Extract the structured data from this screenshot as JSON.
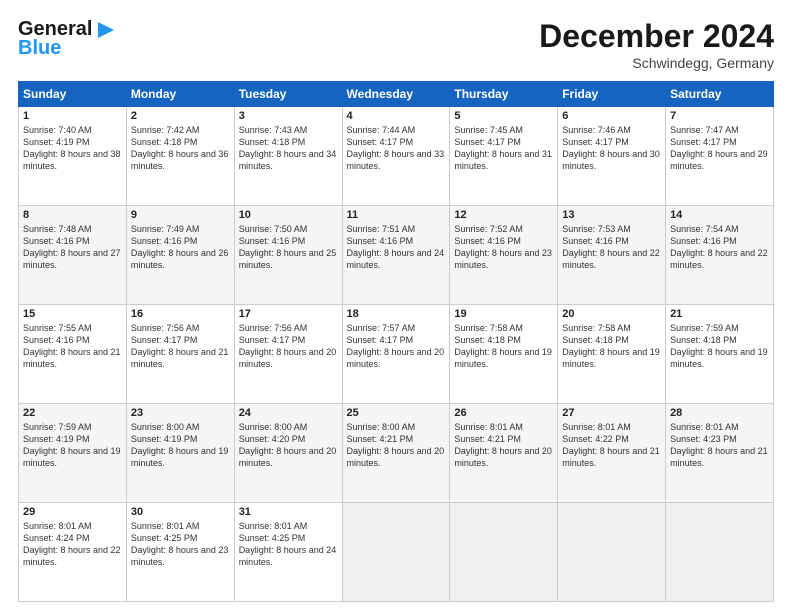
{
  "header": {
    "logo_general": "General",
    "logo_blue": "Blue",
    "month_title": "December 2024",
    "location": "Schwindegg, Germany"
  },
  "weekdays": [
    "Sunday",
    "Monday",
    "Tuesday",
    "Wednesday",
    "Thursday",
    "Friday",
    "Saturday"
  ],
  "weeks": [
    [
      {
        "day": "1",
        "sunrise": "Sunrise: 7:40 AM",
        "sunset": "Sunset: 4:19 PM",
        "daylight": "Daylight: 8 hours and 38 minutes."
      },
      {
        "day": "2",
        "sunrise": "Sunrise: 7:42 AM",
        "sunset": "Sunset: 4:18 PM",
        "daylight": "Daylight: 8 hours and 36 minutes."
      },
      {
        "day": "3",
        "sunrise": "Sunrise: 7:43 AM",
        "sunset": "Sunset: 4:18 PM",
        "daylight": "Daylight: 8 hours and 34 minutes."
      },
      {
        "day": "4",
        "sunrise": "Sunrise: 7:44 AM",
        "sunset": "Sunset: 4:17 PM",
        "daylight": "Daylight: 8 hours and 33 minutes."
      },
      {
        "day": "5",
        "sunrise": "Sunrise: 7:45 AM",
        "sunset": "Sunset: 4:17 PM",
        "daylight": "Daylight: 8 hours and 31 minutes."
      },
      {
        "day": "6",
        "sunrise": "Sunrise: 7:46 AM",
        "sunset": "Sunset: 4:17 PM",
        "daylight": "Daylight: 8 hours and 30 minutes."
      },
      {
        "day": "7",
        "sunrise": "Sunrise: 7:47 AM",
        "sunset": "Sunset: 4:17 PM",
        "daylight": "Daylight: 8 hours and 29 minutes."
      }
    ],
    [
      {
        "day": "8",
        "sunrise": "Sunrise: 7:48 AM",
        "sunset": "Sunset: 4:16 PM",
        "daylight": "Daylight: 8 hours and 27 minutes."
      },
      {
        "day": "9",
        "sunrise": "Sunrise: 7:49 AM",
        "sunset": "Sunset: 4:16 PM",
        "daylight": "Daylight: 8 hours and 26 minutes."
      },
      {
        "day": "10",
        "sunrise": "Sunrise: 7:50 AM",
        "sunset": "Sunset: 4:16 PM",
        "daylight": "Daylight: 8 hours and 25 minutes."
      },
      {
        "day": "11",
        "sunrise": "Sunrise: 7:51 AM",
        "sunset": "Sunset: 4:16 PM",
        "daylight": "Daylight: 8 hours and 24 minutes."
      },
      {
        "day": "12",
        "sunrise": "Sunrise: 7:52 AM",
        "sunset": "Sunset: 4:16 PM",
        "daylight": "Daylight: 8 hours and 23 minutes."
      },
      {
        "day": "13",
        "sunrise": "Sunrise: 7:53 AM",
        "sunset": "Sunset: 4:16 PM",
        "daylight": "Daylight: 8 hours and 22 minutes."
      },
      {
        "day": "14",
        "sunrise": "Sunrise: 7:54 AM",
        "sunset": "Sunset: 4:16 PM",
        "daylight": "Daylight: 8 hours and 22 minutes."
      }
    ],
    [
      {
        "day": "15",
        "sunrise": "Sunrise: 7:55 AM",
        "sunset": "Sunset: 4:16 PM",
        "daylight": "Daylight: 8 hours and 21 minutes."
      },
      {
        "day": "16",
        "sunrise": "Sunrise: 7:56 AM",
        "sunset": "Sunset: 4:17 PM",
        "daylight": "Daylight: 8 hours and 21 minutes."
      },
      {
        "day": "17",
        "sunrise": "Sunrise: 7:56 AM",
        "sunset": "Sunset: 4:17 PM",
        "daylight": "Daylight: 8 hours and 20 minutes."
      },
      {
        "day": "18",
        "sunrise": "Sunrise: 7:57 AM",
        "sunset": "Sunset: 4:17 PM",
        "daylight": "Daylight: 8 hours and 20 minutes."
      },
      {
        "day": "19",
        "sunrise": "Sunrise: 7:58 AM",
        "sunset": "Sunset: 4:18 PM",
        "daylight": "Daylight: 8 hours and 19 minutes."
      },
      {
        "day": "20",
        "sunrise": "Sunrise: 7:58 AM",
        "sunset": "Sunset: 4:18 PM",
        "daylight": "Daylight: 8 hours and 19 minutes."
      },
      {
        "day": "21",
        "sunrise": "Sunrise: 7:59 AM",
        "sunset": "Sunset: 4:18 PM",
        "daylight": "Daylight: 8 hours and 19 minutes."
      }
    ],
    [
      {
        "day": "22",
        "sunrise": "Sunrise: 7:59 AM",
        "sunset": "Sunset: 4:19 PM",
        "daylight": "Daylight: 8 hours and 19 minutes."
      },
      {
        "day": "23",
        "sunrise": "Sunrise: 8:00 AM",
        "sunset": "Sunset: 4:19 PM",
        "daylight": "Daylight: 8 hours and 19 minutes."
      },
      {
        "day": "24",
        "sunrise": "Sunrise: 8:00 AM",
        "sunset": "Sunset: 4:20 PM",
        "daylight": "Daylight: 8 hours and 20 minutes."
      },
      {
        "day": "25",
        "sunrise": "Sunrise: 8:00 AM",
        "sunset": "Sunset: 4:21 PM",
        "daylight": "Daylight: 8 hours and 20 minutes."
      },
      {
        "day": "26",
        "sunrise": "Sunrise: 8:01 AM",
        "sunset": "Sunset: 4:21 PM",
        "daylight": "Daylight: 8 hours and 20 minutes."
      },
      {
        "day": "27",
        "sunrise": "Sunrise: 8:01 AM",
        "sunset": "Sunset: 4:22 PM",
        "daylight": "Daylight: 8 hours and 21 minutes."
      },
      {
        "day": "28",
        "sunrise": "Sunrise: 8:01 AM",
        "sunset": "Sunset: 4:23 PM",
        "daylight": "Daylight: 8 hours and 21 minutes."
      }
    ],
    [
      {
        "day": "29",
        "sunrise": "Sunrise: 8:01 AM",
        "sunset": "Sunset: 4:24 PM",
        "daylight": "Daylight: 8 hours and 22 minutes."
      },
      {
        "day": "30",
        "sunrise": "Sunrise: 8:01 AM",
        "sunset": "Sunset: 4:25 PM",
        "daylight": "Daylight: 8 hours and 23 minutes."
      },
      {
        "day": "31",
        "sunrise": "Sunrise: 8:01 AM",
        "sunset": "Sunset: 4:25 PM",
        "daylight": "Daylight: 8 hours and 24 minutes."
      },
      null,
      null,
      null,
      null
    ]
  ]
}
